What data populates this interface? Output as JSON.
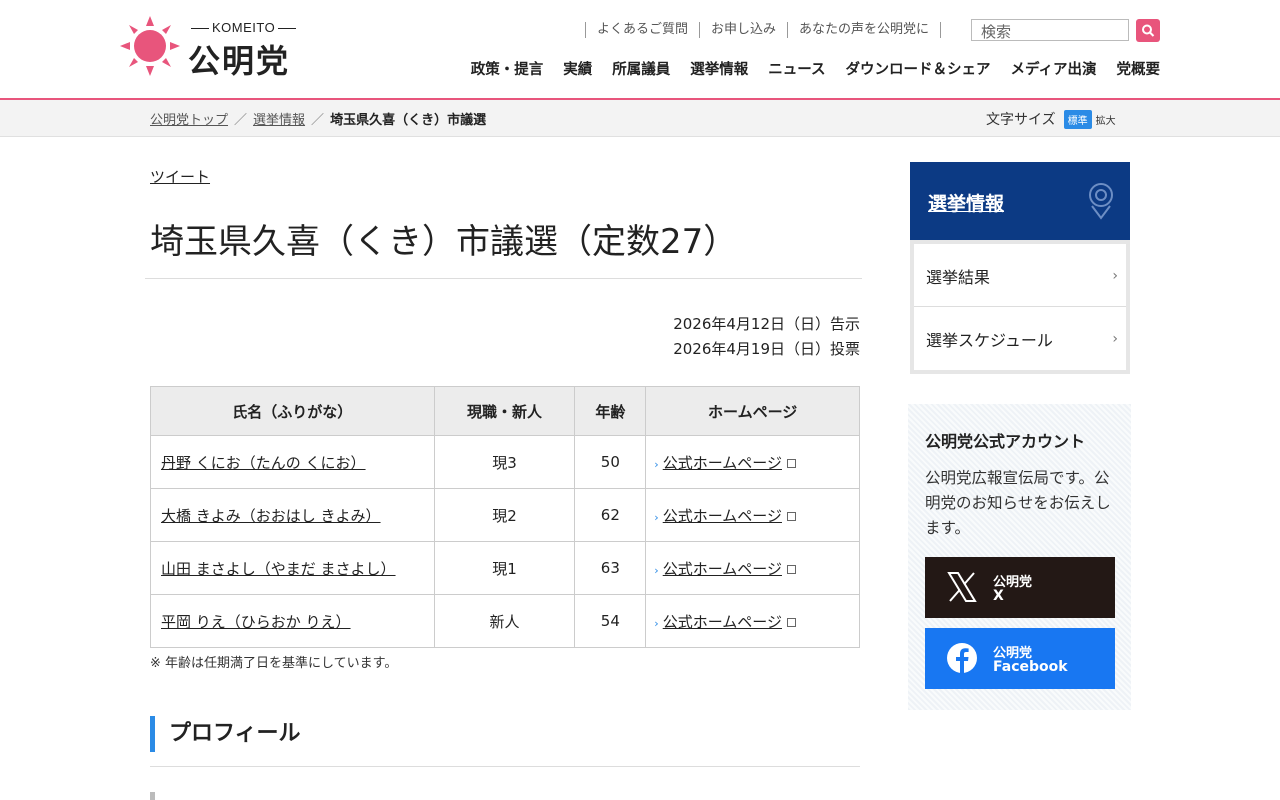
{
  "header": {
    "logo_en": "KOMEITO",
    "logo_jp": "公明党",
    "utility": [
      "よくあるご質問",
      "お申し込み",
      "あなたの声を公明党に"
    ],
    "search_placeholder": "検索",
    "nav": [
      "政策・提言",
      "実績",
      "所属議員",
      "選挙情報",
      "ニュース",
      "ダウンロード＆シェア",
      "メディア出演",
      "党概要"
    ],
    "colors": {
      "accent": "#e8557c",
      "blue": "#2b8be6",
      "navy": "#0c3a84"
    }
  },
  "breadcrumb": {
    "items": [
      "公明党トップ",
      "選挙情報"
    ],
    "current": "埼玉県久喜（くき）市議選"
  },
  "font_size": {
    "label": "文字サイズ",
    "standard": "標準",
    "large": "拡大"
  },
  "main": {
    "tweet": "ツイート",
    "title": "埼玉県久喜（くき）市議選（定数27）",
    "dates": [
      "2026年4月12日（日）告示",
      "2026年4月19日（日）投票"
    ],
    "table": {
      "headers": [
        "氏名（ふりがな）",
        "現職・新人",
        "年齢",
        "ホームページ"
      ],
      "rows": [
        {
          "name": "丹野 くにお（たんの くにお）",
          "status": "現3",
          "age": "50",
          "hp": "公式ホームページ"
        },
        {
          "name": "大橋 きよみ（おおはし きよみ）",
          "status": "現2",
          "age": "62",
          "hp": "公式ホームページ"
        },
        {
          "name": "山田 まさよし（やまだ まさよし）",
          "status": "現1",
          "age": "63",
          "hp": "公式ホームページ"
        },
        {
          "name": "平岡 りえ（ひらおか りえ）",
          "status": "新人",
          "age": "54",
          "hp": "公式ホームページ"
        }
      ]
    },
    "note": "※ 年齢は任期満了日を基準にしています。",
    "profile_heading": "プロフィール"
  },
  "sidebar": {
    "title": "選挙情報",
    "items": [
      "選挙結果",
      "選挙スケジュール"
    ],
    "account": {
      "title": "公明党公式アカウント",
      "description": "公明党広報宣伝局です。公明党のお知らせをお伝えします。",
      "x_line1": "公明党",
      "x_line2": "X",
      "fb_line1": "公明党",
      "fb_line2": "Facebook"
    }
  }
}
